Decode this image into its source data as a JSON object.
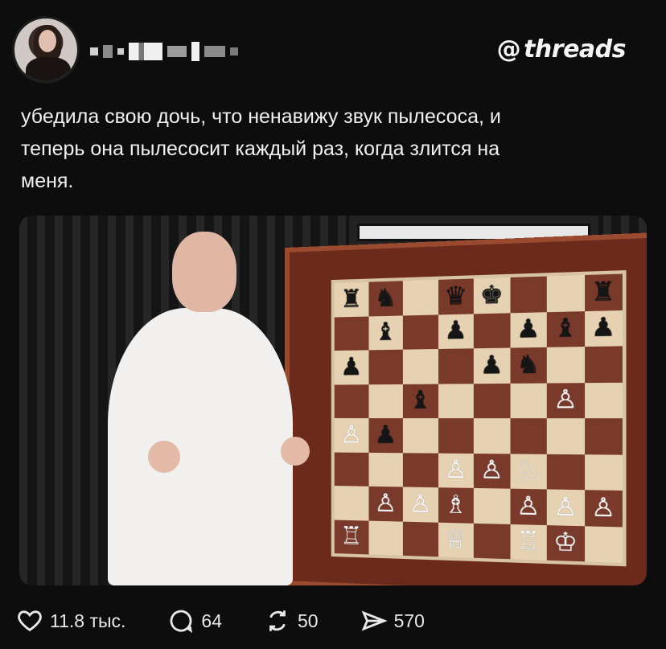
{
  "header": {
    "brand_name": "threads",
    "brand_logo_glyph": "@"
  },
  "post": {
    "text_line1": "убедила свою  дочь, что ненавижу звук пылесоса, и",
    "text_line2": "теперь она пылесосит каждый раз, когда злится на",
    "text_line3": "меня."
  },
  "image": {
    "board": {
      "rows": [
        [
          "♜",
          "♞",
          "",
          "♛",
          "♚",
          "",
          "",
          "♜"
        ],
        [
          "",
          "♝",
          "",
          "♟",
          "",
          "♟",
          "♝",
          "♟"
        ],
        [
          "♟",
          "",
          "",
          "",
          "♟",
          "♞",
          "",
          ""
        ],
        [
          "",
          "",
          "♝",
          "",
          "",
          "",
          "♙",
          ""
        ],
        [
          "♙",
          "♟",
          "",
          "",
          "",
          "",
          "",
          ""
        ],
        [
          "",
          "",
          "",
          "♙",
          "♙",
          "♘",
          "",
          ""
        ],
        [
          "",
          "♙",
          "♙",
          "♗",
          "",
          "♙",
          "♙",
          "♙"
        ],
        [
          "♖",
          "",
          "",
          "♕",
          "",
          "♖",
          "♔",
          ""
        ]
      ],
      "black_pieces": [
        "♜",
        "♞",
        "♝",
        "♛",
        "♚",
        "♟"
      ]
    }
  },
  "actions": {
    "likes": "11.8 тыс.",
    "comments": "64",
    "reposts": "50",
    "shares": "570"
  },
  "colors": {
    "background": "#0d0d0d",
    "text": "#f0f0f0",
    "board_light": "#e6d2b3",
    "board_dark": "#7a3a2b",
    "frame": "#6b2a1b"
  }
}
